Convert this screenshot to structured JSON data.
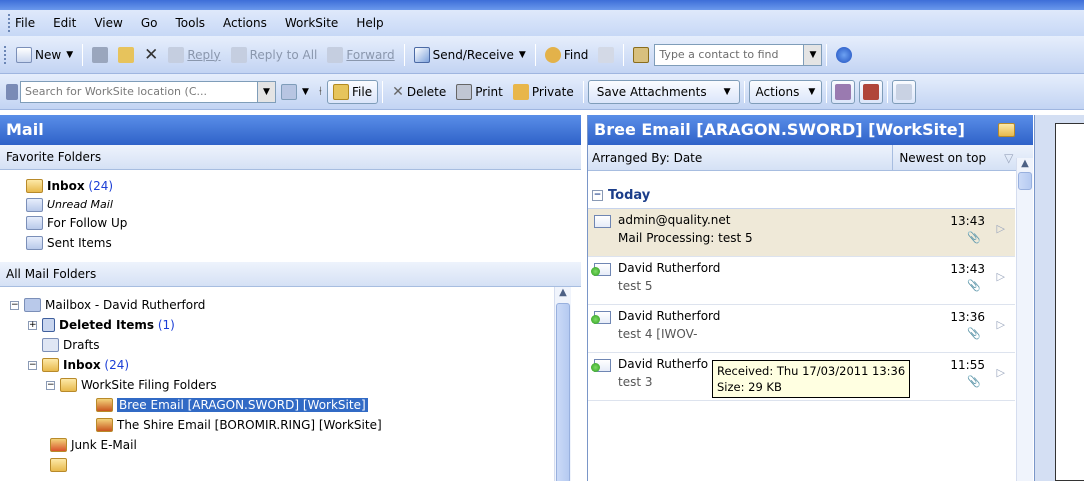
{
  "menu": [
    "File",
    "Edit",
    "View",
    "Go",
    "Tools",
    "Actions",
    "WorkSite",
    "Help"
  ],
  "toolbar1": {
    "new_label": "New",
    "reply_label": "Reply",
    "reply_all_label": "Reply to All",
    "forward_label": "Forward",
    "send_receive_label": "Send/Receive",
    "find_label": "Find",
    "contact_placeholder": "Type a contact to find"
  },
  "toolbar2": {
    "search_placeholder": "Search for WorkSite location (C...",
    "file_label": "File",
    "delete_label": "Delete",
    "print_label": "Print",
    "private_label": "Private",
    "save_attachments_label": "Save Attachments",
    "actions_label": "Actions"
  },
  "left": {
    "title": "Mail",
    "favorite_header": "Favorite Folders",
    "favorites": [
      {
        "label": "Inbox",
        "count": "(24)"
      },
      {
        "label": "Unread Mail"
      },
      {
        "label": "For Follow Up"
      },
      {
        "label": "Sent Items"
      }
    ],
    "all_header": "All Mail Folders",
    "tree": {
      "mailbox": "Mailbox - David Rutherford",
      "deleted": "Deleted Items",
      "deleted_count": "(1)",
      "drafts": "Drafts",
      "inbox": "Inbox",
      "inbox_count": "(24)",
      "worksite_folders": "WorkSite Filing Folders",
      "bree": "Bree Email [ARAGON.SWORD] [WorkSite]",
      "shire": "The Shire Email [BOROMIR.RING] [WorkSite]",
      "junk": "Junk E-Mail"
    }
  },
  "right": {
    "title": "Bree Email [ARAGON.SWORD] [WorkSite]",
    "arranged_by": "Arranged By: Date",
    "sort_order": "Newest on top",
    "group": "Today",
    "messages": [
      {
        "from": "admin@quality.net",
        "subject": "Mail Processing: test 5",
        "time": "13:43"
      },
      {
        "from": "David Rutherford",
        "subject": "test 5",
        "time": "13:43"
      },
      {
        "from": "David Rutherford",
        "subject": "test 4 [IWOV-",
        "time": "13:36"
      },
      {
        "from": "David Rutherfo",
        "subject": "test 3",
        "time": "11:55"
      }
    ]
  },
  "tooltip": {
    "received": "Received: Thu 17/03/2011 13:36",
    "size": "Size: 29 KB"
  },
  "colors": {
    "header_blue": "#2f62c8",
    "selection": "#316ac5",
    "count_blue": "#1c3fd6"
  }
}
